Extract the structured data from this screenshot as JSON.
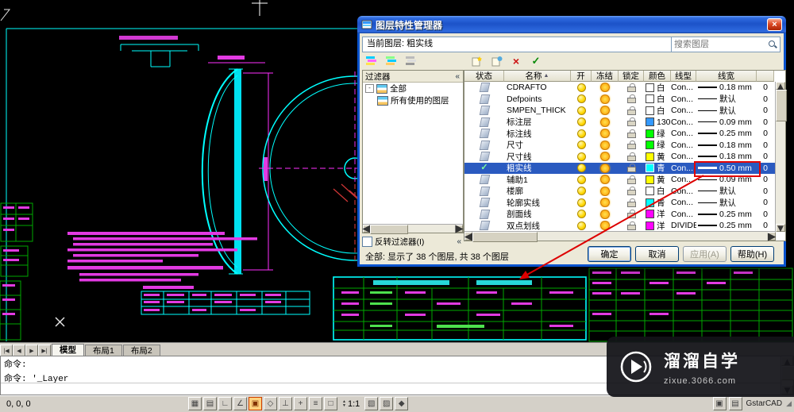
{
  "icons": {
    "close": "×",
    "check": "✓",
    "delete": "×",
    "sort_asc": "▲",
    "collapse": "«",
    "left": "◀",
    "right": "▶",
    "up": "▲",
    "down": "▼",
    "expander": "-",
    "resize_grip": "◢"
  },
  "dialog": {
    "title": "图层特性管理器",
    "current_layer_label": "当前图层:",
    "current_layer_value": "粗实线",
    "search_placeholder": "搜索图层",
    "filters_header": "过滤器",
    "tree_root": "全部",
    "tree_child": "所有使用的图层",
    "invert_filter_label": "反转过滤器(I)",
    "columns": {
      "status": "状态",
      "name": "名称",
      "on": "开",
      "freeze": "冻结",
      "lock": "锁定",
      "color": "颜色",
      "linetype": "线型",
      "lineweight": "线宽",
      "extra": ""
    },
    "rows": [
      {
        "name": "CDRAFTO",
        "color_name": "白",
        "color_hex": "#ffffff",
        "linetype": "Con...",
        "lineweight": "0.18 mm",
        "extra": "0"
      },
      {
        "name": "Defpoints",
        "color_name": "白",
        "color_hex": "#ffffff",
        "linetype": "Con...",
        "lineweight": "默认",
        "extra": "0"
      },
      {
        "name": "SMPEN_THICK",
        "color_name": "白",
        "color_hex": "#ffffff",
        "linetype": "Con...",
        "lineweight": "默认",
        "extra": "0"
      },
      {
        "name": "标注层",
        "color_name": "130",
        "color_hex": "#3399ff",
        "linetype": "Con...",
        "lineweight": "0.09 mm",
        "extra": "0"
      },
      {
        "name": "标注线",
        "color_name": "绿",
        "color_hex": "#00ff00",
        "linetype": "Con...",
        "lineweight": "0.25 mm",
        "extra": "0"
      },
      {
        "name": "尺寸",
        "color_name": "绿",
        "color_hex": "#00ff00",
        "linetype": "Con...",
        "lineweight": "0.18 mm",
        "extra": "0"
      },
      {
        "name": "尺寸线",
        "color_name": "黄",
        "color_hex": "#ffff00",
        "linetype": "Con...",
        "lineweight": "0.18 mm",
        "extra": "0"
      },
      {
        "name": "粗实线",
        "color_name": "青",
        "color_hex": "#00ffff",
        "linetype": "Con...",
        "lineweight": "0.50 mm",
        "extra": "0",
        "selected": true
      },
      {
        "name": "辅助1",
        "color_name": "黄",
        "color_hex": "#ffff00",
        "linetype": "Con...",
        "lineweight": "0.09 mm",
        "extra": "0"
      },
      {
        "name": "楼廓",
        "color_name": "白",
        "color_hex": "#ffffff",
        "linetype": "Con...",
        "lineweight": "默认",
        "extra": "0"
      },
      {
        "name": "轮廓实线",
        "color_name": "青",
        "color_hex": "#00ffff",
        "linetype": "Con...",
        "lineweight": "默认",
        "extra": "0"
      },
      {
        "name": "剖面线",
        "color_name": "洋",
        "color_hex": "#ff00ff",
        "linetype": "Con...",
        "lineweight": "0.25 mm",
        "extra": "0"
      },
      {
        "name": "双点划线",
        "color_name": "洋",
        "color_hex": "#ff00ff",
        "linetype": "DIVIDE",
        "lineweight": "0.25 mm",
        "extra": "0"
      }
    ],
    "footer_status": "全部: 显示了 38 个图层, 共 38 个图层",
    "buttons": {
      "ok": "确定",
      "cancel": "取消",
      "apply": "应用(A)",
      "help": "帮助(H)"
    }
  },
  "tabs": {
    "nav": [
      "|◀",
      "◀",
      "▶",
      "▶|"
    ],
    "items": [
      {
        "label": "模型",
        "active": true
      },
      {
        "label": "布局1",
        "active": false
      },
      {
        "label": "布局2",
        "active": false
      }
    ]
  },
  "command": {
    "lines": [
      "命令:",
      "命令: '_Layer"
    ]
  },
  "statusbar": {
    "coordinates": "0, 0, 0",
    "toggles": [
      {
        "name": "snap",
        "glyph": "▦"
      },
      {
        "name": "grid",
        "glyph": "▤"
      },
      {
        "name": "ortho",
        "glyph": "∟"
      },
      {
        "name": "polar",
        "glyph": "∠"
      },
      {
        "name": "osnap",
        "glyph": "▣",
        "active": true
      },
      {
        "name": "otrack",
        "glyph": "◇"
      },
      {
        "name": "ducs",
        "glyph": "⊥"
      },
      {
        "name": "dyn",
        "glyph": "+"
      },
      {
        "name": "lwt",
        "glyph": "≡"
      },
      {
        "name": "model",
        "glyph": "□"
      }
    ],
    "scale": "1:1",
    "extra_toggles": [
      {
        "name": "quick-properties",
        "glyph": "▧"
      },
      {
        "name": "annotation",
        "glyph": "▨"
      },
      {
        "name": "workspace",
        "glyph": "◆"
      }
    ],
    "right_icons": [
      {
        "name": "toolbar-lock",
        "glyph": "▣"
      },
      {
        "name": "clean-screen",
        "glyph": "▤"
      }
    ],
    "brand": "GstarCAD"
  },
  "watermark": {
    "title": "溜溜自学",
    "url": "zixue.3066.com"
  }
}
